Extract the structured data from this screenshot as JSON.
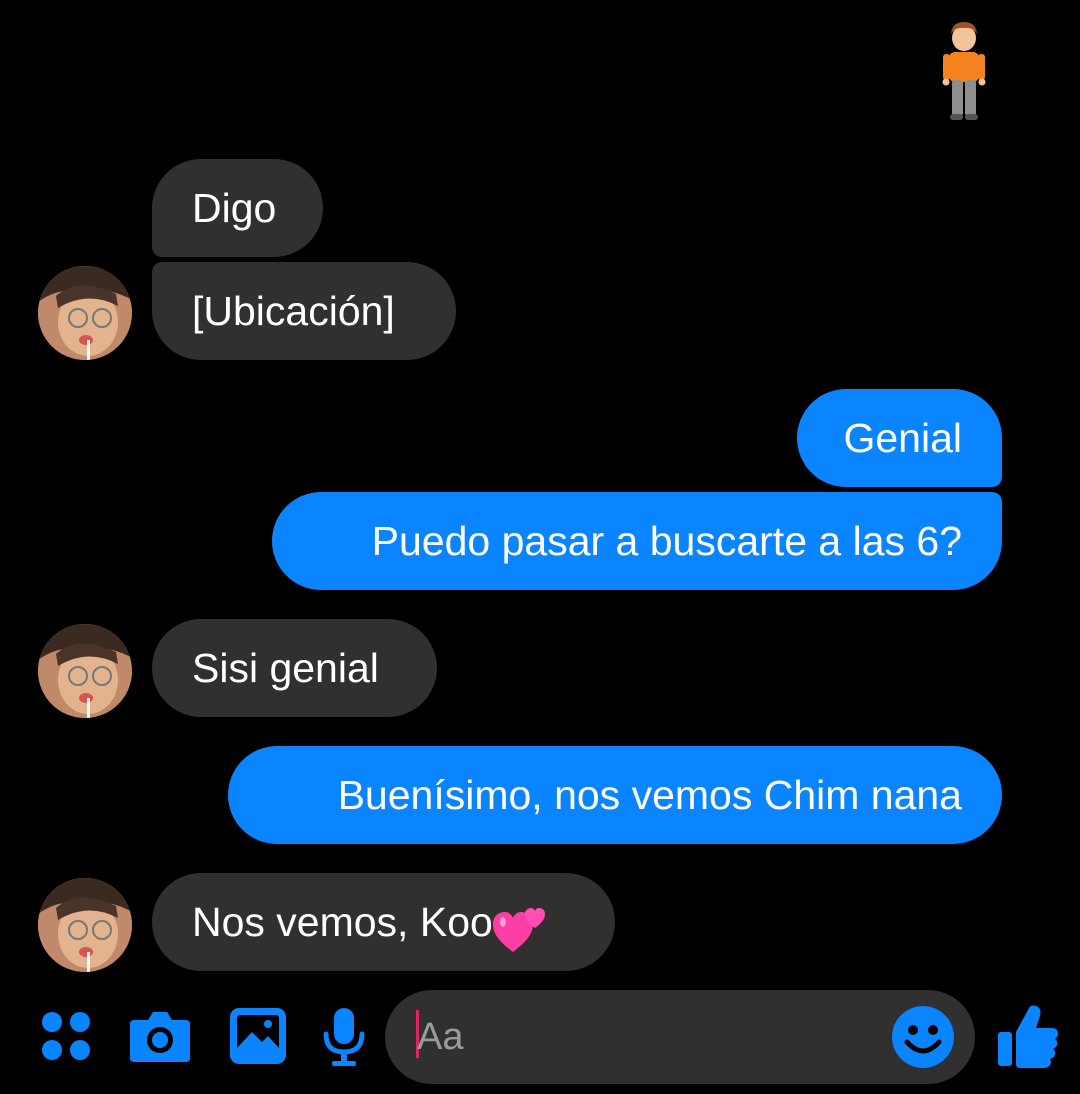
{
  "conversation": {
    "messages": [
      {
        "sender": "contact",
        "text": "Digo"
      },
      {
        "sender": "contact",
        "text": "[Ubicación]"
      },
      {
        "sender": "me",
        "text": "Genial"
      },
      {
        "sender": "me",
        "text": "Puedo pasar a buscarte a las 6?"
      },
      {
        "sender": "contact",
        "text": "Sisi genial"
      },
      {
        "sender": "me",
        "text": "Buenísimo, nos vemos Chim nana"
      },
      {
        "sender": "contact",
        "text": "Nos vemos, Koo",
        "emoji": "two-hearts"
      }
    ]
  },
  "composer": {
    "placeholder": "Aa"
  },
  "toolbar": {
    "icons": [
      "apps-icon",
      "camera-icon",
      "gallery-icon",
      "microphone-icon",
      "emoji-icon",
      "thumbs-up-icon"
    ]
  },
  "colors": {
    "accent": "#0a84ff",
    "incoming_bubble": "#303030",
    "background": "#000000"
  }
}
